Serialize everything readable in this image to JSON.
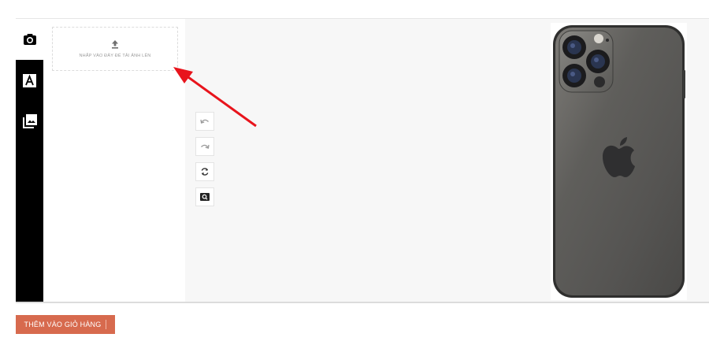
{
  "side_tabs": [
    {
      "icon": "camera-icon",
      "active": true
    },
    {
      "icon": "text-icon",
      "active": false
    },
    {
      "icon": "image-gallery-icon",
      "active": false
    }
  ],
  "upload": {
    "icon": "upload-icon",
    "label": "NHẤP VÀO ĐÂY ĐỂ TẢI ẢNH LÊN"
  },
  "tools": [
    {
      "icon": "undo-icon"
    },
    {
      "icon": "redo-icon"
    },
    {
      "icon": "reset-icon"
    },
    {
      "icon": "zoom-icon"
    }
  ],
  "product": {
    "icon": "phone-back-image"
  },
  "annotation": {
    "color": "#e8141c"
  },
  "cart": {
    "label": "THÊM VÀO GIỎ HÀNG",
    "color": "#d76a4e"
  }
}
